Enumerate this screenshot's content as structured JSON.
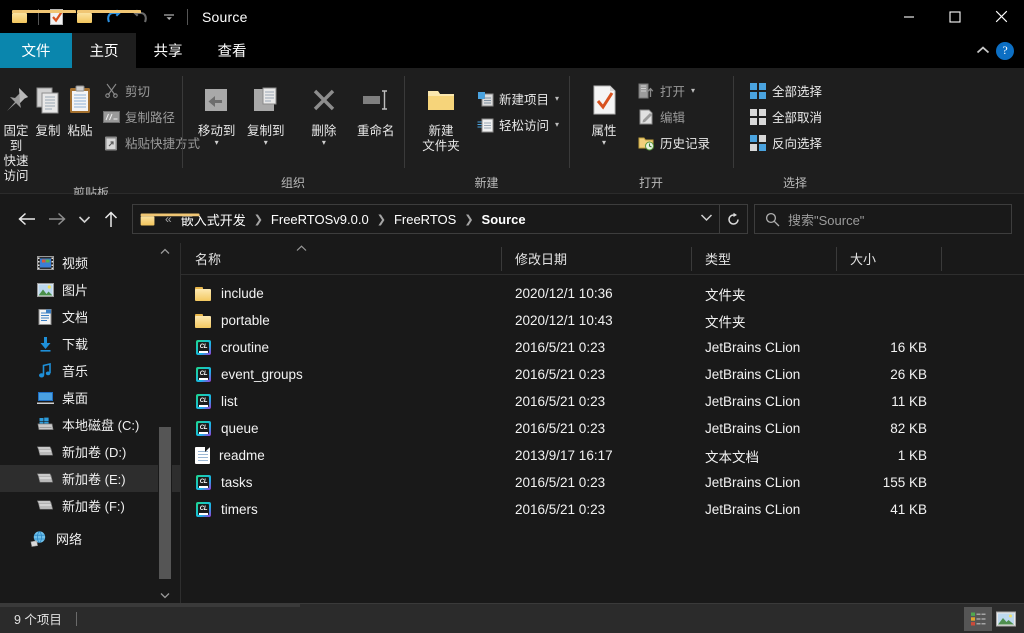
{
  "window": {
    "title": "Source",
    "quick_access": [
      "folder-icon",
      "separator",
      "properties-icon",
      "new-folder-icon",
      "undo-icon",
      "redo-icon",
      "customize-dropdown-icon"
    ],
    "controls": {
      "minimize": "minimize-icon",
      "maximize": "maximize-icon",
      "close": "close-icon"
    }
  },
  "ribbon": {
    "tabs": [
      {
        "label": "文件",
        "kind": "file"
      },
      {
        "label": "主页",
        "kind": "active"
      },
      {
        "label": "共享",
        "kind": "normal"
      },
      {
        "label": "查看",
        "kind": "normal"
      }
    ],
    "collapse_icon": "chevron-up-icon",
    "help_label": "?",
    "groups": [
      {
        "name": "剪贴板",
        "big": [
          {
            "label_line1": "固定到",
            "label_line2": "快速访问",
            "icon": "pin-icon"
          },
          {
            "label_line1": "复制",
            "label_line2": "",
            "icon": "copy-icon"
          },
          {
            "label_line1": "粘贴",
            "label_line2": "",
            "icon": "paste-icon"
          }
        ],
        "small": [
          {
            "label": "剪切",
            "icon": "scissors-icon",
            "dim": true
          },
          {
            "label": "复制路径",
            "icon": "copy-path-icon",
            "dim": true
          },
          {
            "label": "粘贴快捷方式",
            "icon": "paste-shortcut-icon",
            "dim": true
          }
        ]
      },
      {
        "name": "组织",
        "big": [
          {
            "label_line1": "移动到",
            "label_line2": "",
            "icon": "move-to-icon",
            "arrow": true
          },
          {
            "label_line1": "复制到",
            "label_line2": "",
            "icon": "copy-to-icon",
            "arrow": true
          },
          {
            "label_line1": "删除",
            "label_line2": "",
            "icon": "delete-icon",
            "arrow": true
          },
          {
            "label_line1": "重命名",
            "label_line2": "",
            "icon": "rename-icon"
          }
        ],
        "small": []
      },
      {
        "name": "新建",
        "big": [
          {
            "label_line1": "新建",
            "label_line2": "文件夹",
            "icon": "new-folder-icon"
          }
        ],
        "small": [
          {
            "label": "新建项目",
            "icon": "new-item-icon",
            "dropdown": true
          },
          {
            "label": "轻松访问",
            "icon": "easy-access-icon",
            "dropdown": true
          }
        ]
      },
      {
        "name": "打开",
        "big": [
          {
            "label_line1": "属性",
            "label_line2": "",
            "icon": "properties-icon",
            "arrow": true
          }
        ],
        "small": [
          {
            "label": "打开",
            "icon": "open-icon",
            "dropdown": true,
            "dim": true
          },
          {
            "label": "编辑",
            "icon": "edit-icon",
            "dim": true
          },
          {
            "label": "历史记录",
            "icon": "history-icon"
          }
        ]
      },
      {
        "name": "选择",
        "big": [],
        "small": [
          {
            "label": "全部选择",
            "icon": "select-all-icon"
          },
          {
            "label": "全部取消",
            "icon": "select-none-icon"
          },
          {
            "label": "反向选择",
            "icon": "invert-selection-icon"
          }
        ]
      }
    ]
  },
  "address": {
    "back_icon": "back-arrow-icon",
    "forward_icon": "forward-arrow-icon",
    "recent_icon": "chevron-down-icon",
    "up_icon": "up-arrow-icon",
    "breadcrumbs": [
      "嵌入式开发",
      "FreeRTOSv9.0.0",
      "FreeRTOS",
      "Source"
    ],
    "overflow": "«",
    "dropdown_icon": "chevron-down-icon",
    "refresh_icon": "refresh-icon",
    "search_placeholder": "搜索\"Source\"",
    "search_value": "",
    "search_icon": "search-icon"
  },
  "navpane": {
    "items": [
      {
        "label": "视频",
        "icon": "videos-icon",
        "selected": false
      },
      {
        "label": "图片",
        "icon": "pictures-icon",
        "selected": false
      },
      {
        "label": "文档",
        "icon": "documents-icon",
        "selected": false
      },
      {
        "label": "下载",
        "icon": "downloads-icon",
        "selected": false
      },
      {
        "label": "音乐",
        "icon": "music-icon",
        "selected": false
      },
      {
        "label": "桌面",
        "icon": "desktop-icon",
        "selected": false
      },
      {
        "label": "本地磁盘 (C:)",
        "icon": "system-drive-icon",
        "selected": false
      },
      {
        "label": "新加卷 (D:)",
        "icon": "drive-icon",
        "selected": false
      },
      {
        "label": "新加卷 (E:)",
        "icon": "drive-icon",
        "selected": true
      },
      {
        "label": "新加卷 (F:)",
        "icon": "drive-icon",
        "selected": false
      },
      {
        "label": "网络",
        "icon": "network-icon",
        "selected": false
      }
    ],
    "scroll_up_icon": "scroll-up-icon",
    "scroll_down_icon": "scroll-down-icon"
  },
  "filelist": {
    "columns": [
      "名称",
      "修改日期",
      "类型",
      "大小"
    ],
    "sort_indicator": "^",
    "rows": [
      {
        "name": "include",
        "date": "2020/12/1 10:36",
        "type": "文件夹",
        "size": "",
        "icon": "folder-icon"
      },
      {
        "name": "portable",
        "date": "2020/12/1 10:43",
        "type": "文件夹",
        "size": "",
        "icon": "folder-icon"
      },
      {
        "name": "croutine",
        "date": "2016/5/21 0:23",
        "type": "JetBrains CLion",
        "size": "16 KB",
        "icon": "clion-file-icon"
      },
      {
        "name": "event_groups",
        "date": "2016/5/21 0:23",
        "type": "JetBrains CLion",
        "size": "26 KB",
        "icon": "clion-file-icon"
      },
      {
        "name": "list",
        "date": "2016/5/21 0:23",
        "type": "JetBrains CLion",
        "size": "11 KB",
        "icon": "clion-file-icon"
      },
      {
        "name": "queue",
        "date": "2016/5/21 0:23",
        "type": "JetBrains CLion",
        "size": "82 KB",
        "icon": "clion-file-icon"
      },
      {
        "name": "readme",
        "date": "2013/9/17 16:17",
        "type": "文本文档",
        "size": "1 KB",
        "icon": "text-file-icon"
      },
      {
        "name": "tasks",
        "date": "2016/5/21 0:23",
        "type": "JetBrains CLion",
        "size": "155 KB",
        "icon": "clion-file-icon"
      },
      {
        "name": "timers",
        "date": "2016/5/21 0:23",
        "type": "JetBrains CLion",
        "size": "41 KB",
        "icon": "clion-file-icon"
      }
    ]
  },
  "statusbar": {
    "item_count": "9 个项目",
    "views": [
      {
        "name": "details-view",
        "selected": true
      },
      {
        "name": "large-icons-view",
        "selected": false
      }
    ]
  },
  "colors": {
    "accent": "#0a86ad",
    "window_bg": "#191919",
    "ribbon_bg": "#1e1e1e",
    "status_bg": "#2b2b2b",
    "help_blue": "#0c6fc4",
    "folder_yellow": "#f3c860"
  }
}
